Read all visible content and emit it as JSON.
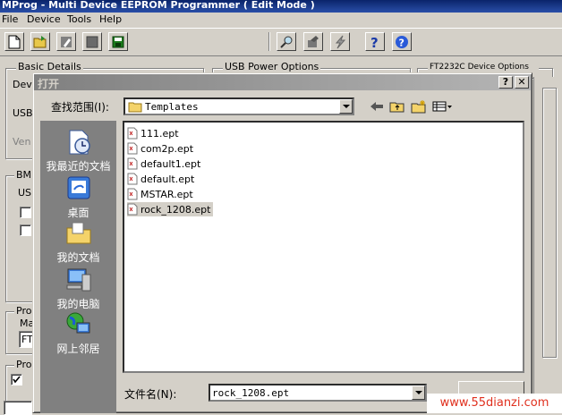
{
  "app": {
    "title": "MProg - Multi Device EEPROM Programmer ( Edit Mode )",
    "menu": [
      {
        "label": "File"
      },
      {
        "label": "Device"
      },
      {
        "label": "Tools"
      },
      {
        "label": "Help"
      }
    ],
    "toolbar_icons": [
      "new-file-icon",
      "open-folder-icon",
      "edit-icon",
      "stop-icon",
      "save-icon",
      "search-icon",
      "hammer-icon",
      "lightning-icon",
      "help-icon",
      "about-icon"
    ],
    "groups": {
      "basic_details": "Basic Details",
      "usb_power_options": "USB Power Options",
      "right_group_partial": "FT2232C Device Options"
    },
    "partial_labels": {
      "dev": "Dev",
      "usb": "USB",
      "ven": "Ven",
      "bm": "BM",
      "us": "US",
      "pro1": "Pro",
      "ma": "Ma",
      "ft": "FT",
      "pro2": "Pro"
    }
  },
  "dialog": {
    "title": "打开",
    "help_button": "?",
    "close_button": "✕",
    "lookin_label": "查找范围(I):",
    "lookin_value": "Templates",
    "places": [
      {
        "label": "我最近的文档",
        "icon": "recent-documents-icon"
      },
      {
        "label": "桌面",
        "icon": "desktop-icon"
      },
      {
        "label": "我的文档",
        "icon": "my-documents-icon"
      },
      {
        "label": "我的电脑",
        "icon": "my-computer-icon"
      },
      {
        "label": "网上邻居",
        "icon": "network-places-icon"
      }
    ],
    "files": [
      {
        "name": "111.ept"
      },
      {
        "name": "com2p.ept"
      },
      {
        "name": "default1.ept"
      },
      {
        "name": "default.ept"
      },
      {
        "name": "MSTAR.ept"
      },
      {
        "name": "rock_1208.ept"
      }
    ],
    "selected_file": "rock_1208.ept",
    "filename_label": "文件名(N):",
    "filename_value": "rock_1208.ept"
  },
  "watermark": "www.55dianzi.com"
}
